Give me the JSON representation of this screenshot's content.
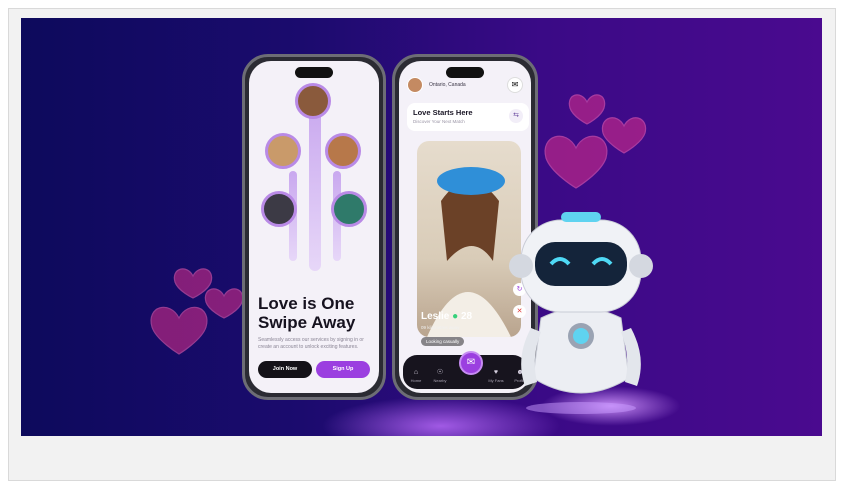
{
  "app_screen": {
    "headline": "Love is One Swipe Away",
    "description": "Seamlessly access our services by signing in or create an account to unlock exciting features.",
    "join_label": "Join Now",
    "signup_label": "Sign Up"
  },
  "match_screen": {
    "location": "Ontario, Canada",
    "card_title": "Love Starts Here",
    "card_subtitle": "Discover Your Next Match",
    "profile_name": "Leslie",
    "profile_age": "28",
    "profile_distance": "09 kilometres away",
    "profile_status": "Looking casually",
    "nav": [
      {
        "label": "Home",
        "icon": "home-icon"
      },
      {
        "label": "Nearby",
        "icon": "location-icon"
      },
      {
        "label": "My Fans",
        "icon": "fans-icon"
      },
      {
        "label": "Profile",
        "icon": "profile-icon"
      }
    ]
  },
  "colors": {
    "background_left": "#0d0a5c",
    "background_right": "#4a0a8f",
    "accent": "#9b3fe0",
    "heart": "#e0308a"
  }
}
